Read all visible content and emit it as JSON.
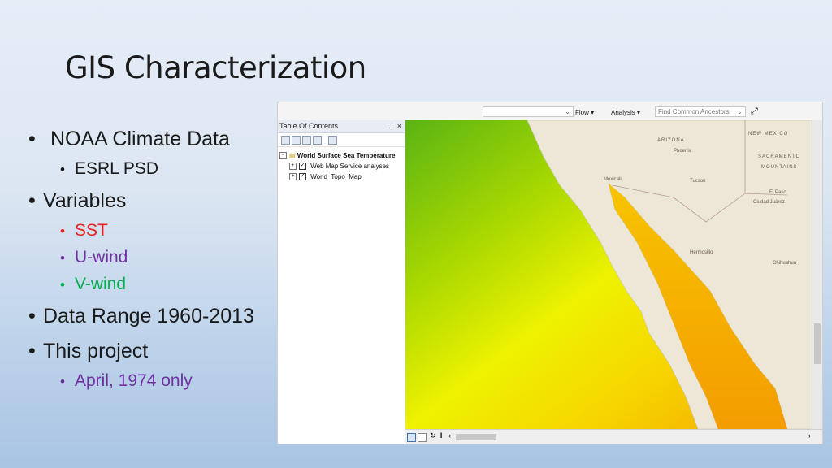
{
  "title": "GIS Characterization",
  "bullets": [
    {
      "text": "NOAA Climate Data",
      "level": 1,
      "color": "#1a1a1a",
      "children": [
        {
          "text": "ESRL PSD",
          "color": "#1a1a1a"
        }
      ]
    },
    {
      "text": "Variables",
      "level": 1,
      "color": "#1a1a1a",
      "children": [
        {
          "text": "SST",
          "color": "#e8221a"
        },
        {
          "text": "U-wind",
          "color": "#7030a0"
        },
        {
          "text": "V-wind",
          "color": "#00b050"
        }
      ]
    },
    {
      "text": "Data Range 1960-2013",
      "level": 1,
      "color": "#1a1a1a"
    },
    {
      "text": "This project",
      "level": 1,
      "color": "#1a1a1a",
      "children": [
        {
          "text": "April, 1974 only",
          "color": "#7030a0"
        }
      ]
    }
  ],
  "gis": {
    "toolbar": {
      "flow_label": "Flow",
      "analysis_label": "Analysis",
      "search_placeholder": "Find Common Ancestors"
    },
    "toc": {
      "title": "Table Of Contents",
      "pin": "⌒",
      "close": "×",
      "layers": [
        {
          "label": "World Surface Sea Temperature",
          "bold": true
        },
        {
          "label": "Web Map Service analyses",
          "bold": false
        },
        {
          "label": "World_Topo_Map",
          "bold": false
        }
      ]
    },
    "map_labels": {
      "new_mexico": "NEW MEXICO",
      "arizona": "ARIZONA",
      "sacramento": "SACRAMENTO",
      "mountains": "MOUNTAINS",
      "tucson": "Tucson",
      "el_paso": "El Paso",
      "ciudad_juarez": "Ciudad Juárez",
      "hermosillo": "Hermosillo",
      "chihuahua": "Chihuahua",
      "mexicali": "Mexicali",
      "phoenix": "Phoenix"
    },
    "colors": {
      "sea_cool": "#7cc21a",
      "sea_mid": "#e8f000",
      "sea_warm": "#f5b800",
      "land": "#ece7d6"
    }
  }
}
